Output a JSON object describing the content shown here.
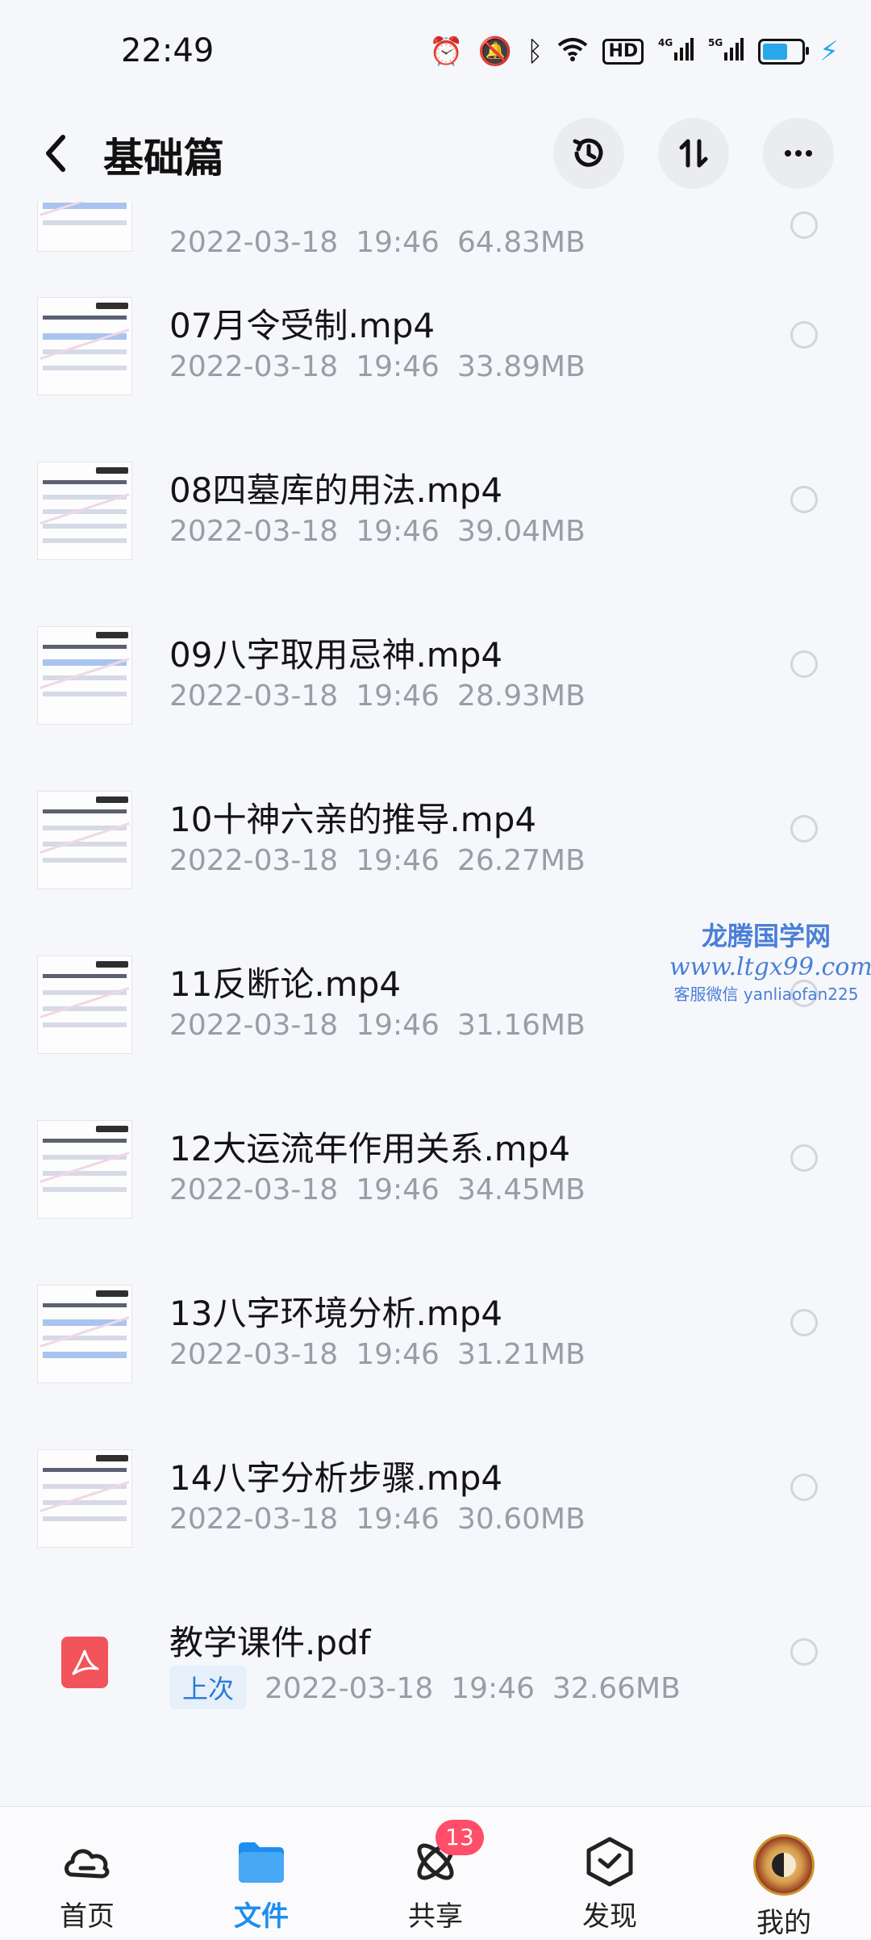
{
  "status_bar": {
    "time": "22:49",
    "icons": [
      "alarm-icon",
      "mute-vibrate-icon",
      "bluetooth-icon",
      "wifi-icon",
      "hd-icon",
      "signal-4g-icon",
      "signal-5g-icon",
      "battery-icon",
      "charging-icon"
    ],
    "hd_label": "HD",
    "net1": "4G",
    "net2": "5G"
  },
  "header": {
    "title": "基础篇",
    "actions": [
      "history-icon",
      "sort-icon",
      "more-icon"
    ]
  },
  "files": [
    {
      "name": "",
      "date": "2022-03-18",
      "time": "19:46",
      "size": "64.83MB",
      "icon": "video-thumbnail"
    },
    {
      "name": "07月令受制.mp4",
      "date": "2022-03-18",
      "time": "19:46",
      "size": "33.89MB",
      "icon": "video-thumbnail"
    },
    {
      "name": "08四墓库的用法.mp4",
      "date": "2022-03-18",
      "time": "19:46",
      "size": "39.04MB",
      "icon": "video-thumbnail"
    },
    {
      "name": "09八字取用忌神.mp4",
      "date": "2022-03-18",
      "time": "19:46",
      "size": "28.93MB",
      "icon": "video-thumbnail"
    },
    {
      "name": "10十神六亲的推导.mp4",
      "date": "2022-03-18",
      "time": "19:46",
      "size": "26.27MB",
      "icon": "video-thumbnail"
    },
    {
      "name": "11反断论.mp4",
      "date": "2022-03-18",
      "time": "19:46",
      "size": "31.16MB",
      "icon": "video-thumbnail"
    },
    {
      "name": "12大运流年作用关系.mp4",
      "date": "2022-03-18",
      "time": "19:46",
      "size": "34.45MB",
      "icon": "video-thumbnail"
    },
    {
      "name": "13八字环境分析.mp4",
      "date": "2022-03-18",
      "time": "19:46",
      "size": "31.21MB",
      "icon": "video-thumbnail"
    },
    {
      "name": "14八字分析步骤.mp4",
      "date": "2022-03-18",
      "time": "19:46",
      "size": "30.60MB",
      "icon": "video-thumbnail"
    },
    {
      "name": "教学课件.pdf",
      "tag": "上次",
      "date": "2022-03-18",
      "time": "19:46",
      "size": "32.66MB",
      "icon": "pdf-icon"
    }
  ],
  "watermark": {
    "title": "龙腾国学网",
    "url": "www.ltgx99.com",
    "sub": "客服微信 yanliaofan225"
  },
  "bottom_nav": [
    {
      "label": "首页",
      "icon": "cloud-home-icon",
      "active": false
    },
    {
      "label": "文件",
      "icon": "folder-icon",
      "active": true
    },
    {
      "label": "共享",
      "icon": "share-orbit-icon",
      "active": false,
      "badge": "13"
    },
    {
      "label": "发现",
      "icon": "discover-cube-icon",
      "active": false
    },
    {
      "label": "我的",
      "icon": "avatar",
      "active": false
    }
  ],
  "colors": {
    "accent": "#1e8ef0",
    "badge": "#ff4d6a",
    "pdf": "#f2545b",
    "background": "#f6f7fb"
  }
}
